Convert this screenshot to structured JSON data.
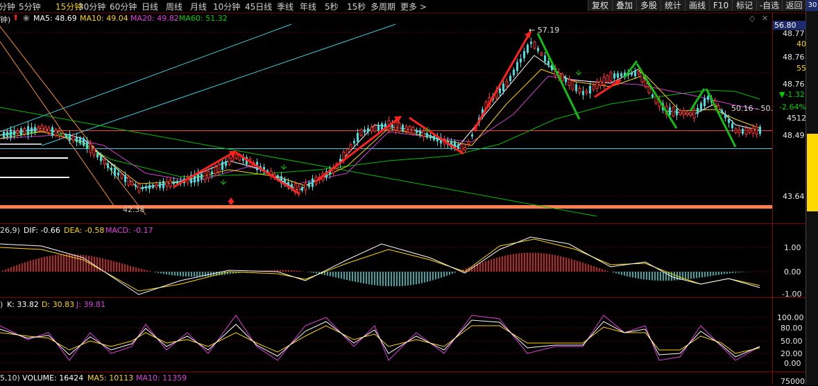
{
  "periods": [
    {
      "label": "分钟",
      "active": false
    },
    {
      "label": "5分钟",
      "active": false
    },
    {
      "label": "15分钟",
      "active": true
    },
    {
      "label": "30分钟",
      "active": false
    },
    {
      "label": "60分钟",
      "active": false
    },
    {
      "label": "日线",
      "active": false
    },
    {
      "label": "周线",
      "active": false
    },
    {
      "label": "月线",
      "active": false
    },
    {
      "label": "10分钟",
      "active": false
    },
    {
      "label": "45日线",
      "active": false
    },
    {
      "label": "季线",
      "active": false
    },
    {
      "label": "年线",
      "active": false
    },
    {
      "label": "5秒",
      "active": false
    },
    {
      "label": "15秒",
      "active": false
    },
    {
      "label": "多周期",
      "active": false
    },
    {
      "label": "更多 >",
      "active": false
    }
  ],
  "toolbar": {
    "fuquan": "复权",
    "diejia": "叠加",
    "duogu": "多股",
    "tongji": "统计",
    "huaxian": "画线",
    "f10": "F10",
    "biaoji": "标记",
    "zixuan": "-自选",
    "fanhui": "返回"
  },
  "sidebar": {
    "top": "30"
  },
  "ma_legend": {
    "prefix": "钟)",
    "ma5": "MA5: 48.69",
    "ma10": "MA10: 49.04",
    "ma20": "MA20: 49.82",
    "ma60": "MA60: 51.32"
  },
  "macd_legend": {
    "prefix": "26,9)",
    "dif": "DIF: -0.66",
    "dea": "DEA: -0.58",
    "macd": "MACD: -0.17"
  },
  "kdj_legend": {
    "prefix": ")",
    "k": "K: 33.82",
    "d": "D: 30.83",
    "j": "J: 39.81"
  },
  "vol_legend": {
    "prefix": "5,10)",
    "volume": "VOLUME: 16424",
    "ma5": "MA5: 10113",
    "ma10": "MA10: 11359"
  },
  "price_axis": {
    "current": "56.80",
    "l1": "48.77",
    "l2": "40",
    "l3": "48.76",
    "l4": "55",
    "l5": "48.76",
    "l6": "▼-1.32",
    "l7": "-2.64%",
    "l8": "4512",
    "l9": "48.49",
    "l10": "43.64"
  },
  "macd_axis": [
    "1.00",
    "0.00",
    "-1.00"
  ],
  "kdj_axis": [
    "100.00",
    "80.00",
    "50.00",
    "20.00",
    "0.00"
  ],
  "vol_axis": "75000",
  "annotations": {
    "high": "57.19",
    "low": "42.38",
    "right": "50.16 - 50."
  },
  "colors": {
    "up": "#ff3030",
    "down": "#40e0e0",
    "ma5": "#ffffff",
    "ma10": "#ffd800",
    "ma20": "#e040e0",
    "ma60": "#00d000",
    "active": "#f0d000"
  }
}
